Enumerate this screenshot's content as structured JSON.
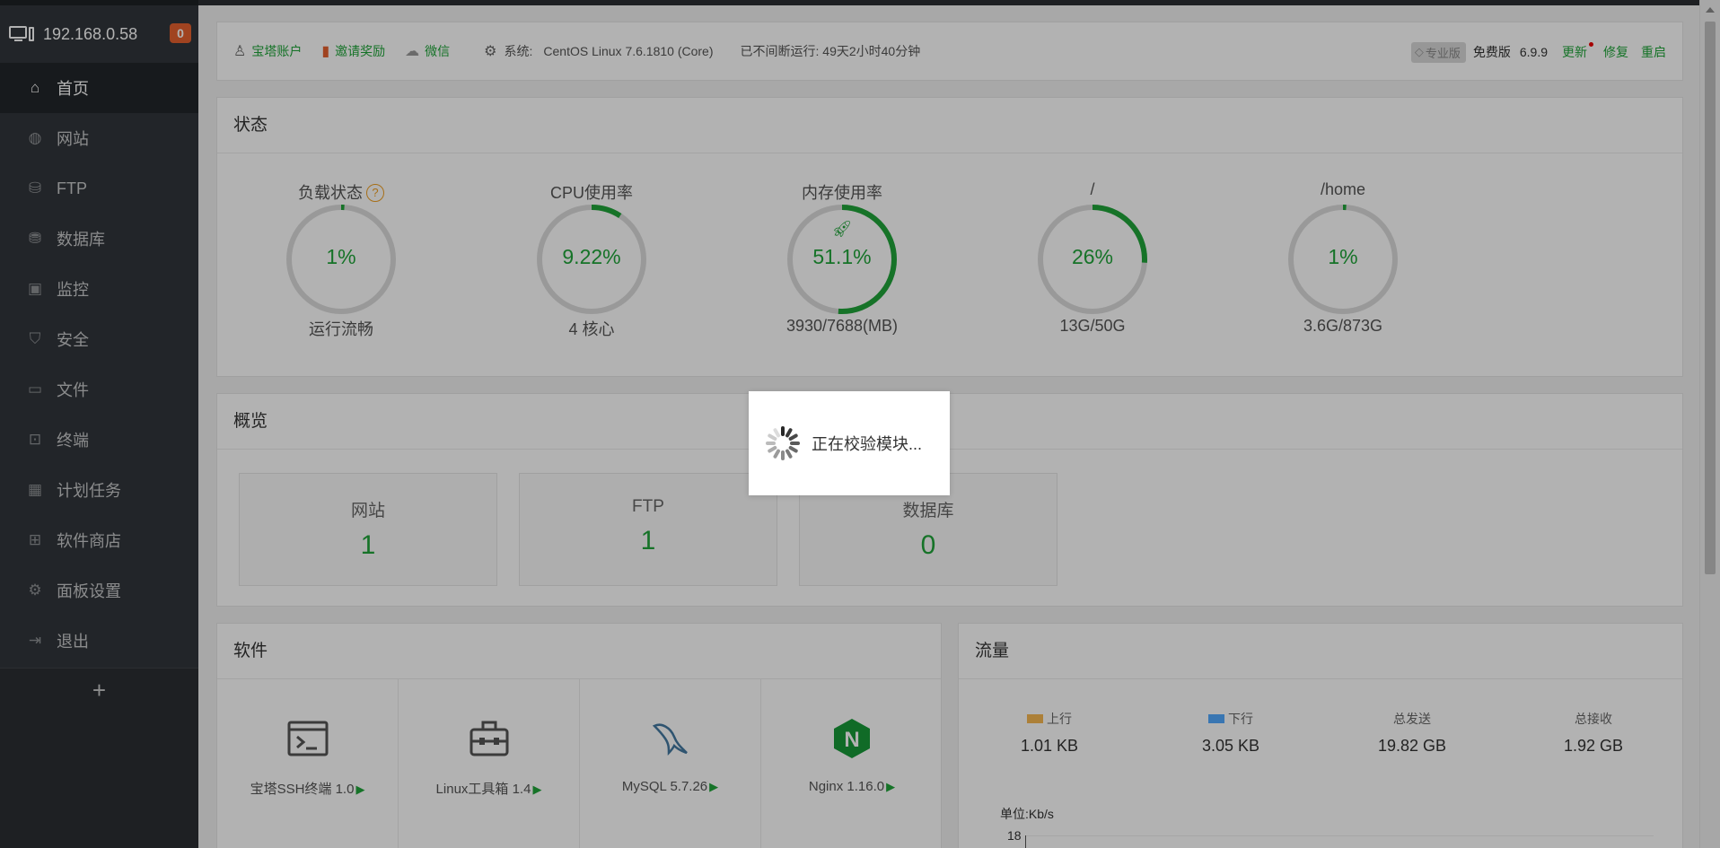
{
  "sidebar": {
    "host": "192.168.0.58",
    "badge": "0",
    "items": [
      {
        "label": "首页",
        "icon": "home-icon"
      },
      {
        "label": "网站",
        "icon": "globe-icon"
      },
      {
        "label": "FTP",
        "icon": "ftp-icon"
      },
      {
        "label": "数据库",
        "icon": "database-icon"
      },
      {
        "label": "监控",
        "icon": "monitor-icon"
      },
      {
        "label": "安全",
        "icon": "shield-icon"
      },
      {
        "label": "文件",
        "icon": "folder-icon"
      },
      {
        "label": "终端",
        "icon": "terminal-icon"
      },
      {
        "label": "计划任务",
        "icon": "calendar-icon"
      },
      {
        "label": "软件商店",
        "icon": "apps-icon"
      },
      {
        "label": "面板设置",
        "icon": "gear-icon"
      },
      {
        "label": "退出",
        "icon": "logout-icon"
      }
    ],
    "add": "+"
  },
  "header": {
    "account": "宝塔账户",
    "invite": "邀请奖励",
    "wechat": "微信",
    "system_label": "系统:",
    "system_value": "CentOS Linux 7.6.1810 (Core)",
    "uptime": "已不间断运行: 49天2小时40分钟",
    "pro": "专业版",
    "free": "免费版",
    "version": "6.9.9",
    "update": "更新",
    "repair": "修复",
    "restart": "重启"
  },
  "status": {
    "title": "状态",
    "gauges": [
      {
        "name": "负载状态",
        "value": "1%",
        "percent": 1,
        "sub": "运行流畅",
        "help": "?"
      },
      {
        "name": "CPU使用率",
        "value": "9.22%",
        "percent": 9.22,
        "sub": "4 核心"
      },
      {
        "name": "内存使用率",
        "value": "51.1%",
        "percent": 51.1,
        "sub": "3930/7688(MB)",
        "rocket": true
      },
      {
        "name": "/",
        "value": "26%",
        "percent": 26,
        "sub": "13G/50G"
      },
      {
        "name": "/home",
        "value": "1%",
        "percent": 1,
        "sub": "3.6G/873G"
      }
    ]
  },
  "overview": {
    "title": "概览",
    "boxes": [
      {
        "label": "网站",
        "value": "1"
      },
      {
        "label": "FTP",
        "value": "1"
      },
      {
        "label": "数据库",
        "value": "0"
      }
    ]
  },
  "software": {
    "title": "软件",
    "items": [
      {
        "name": "宝塔SSH终端 1.0",
        "icon": "terminal-app-icon"
      },
      {
        "name": "Linux工具箱 1.4",
        "icon": "toolbox-icon"
      },
      {
        "name": "MySQL 5.7.26",
        "icon": "mysql-dolphin-icon"
      },
      {
        "name": "Nginx 1.16.0",
        "icon": "nginx-icon"
      }
    ],
    "play": "▶"
  },
  "traffic": {
    "title": "流量",
    "up_label": "上行",
    "up_value": "1.01 KB",
    "down_label": "下行",
    "down_value": "3.05 KB",
    "sent_label": "总发送",
    "sent_value": "19.82 GB",
    "recv_label": "总接收",
    "recv_value": "1.92 GB",
    "unit": "单位:Kb/s",
    "ytick": "18",
    "up_color": "#f7b851",
    "down_color": "#52a9ff"
  },
  "loading": {
    "text": "正在校验模块..."
  },
  "colors": {
    "accent": "#20a53a",
    "track": "#dcdcdc"
  }
}
